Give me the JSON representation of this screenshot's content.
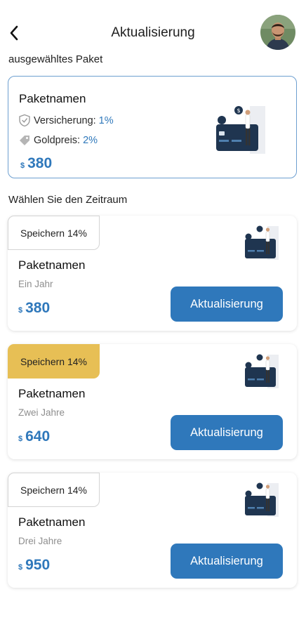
{
  "header": {
    "title": "Aktualisierung",
    "back_icon": "chevron-left-icon",
    "avatar": "user-avatar"
  },
  "selected_section": {
    "label": "ausgewähltes Paket",
    "card": {
      "name": "Paketnamen",
      "insurance_label": "Versicherung:",
      "insurance_value": "1%",
      "gold_label": "Goldpreis:",
      "gold_value": "2%",
      "currency": "$",
      "price": "380",
      "illustration_icon": "payment-card-illustration"
    }
  },
  "period_section": {
    "label": "Wählen Sie den Zeitraum"
  },
  "plans": [
    {
      "badge": "Speichern 14%",
      "badge_style": "outline",
      "name": "Paketnamen",
      "period": "Ein Jahr",
      "currency": "$",
      "price": "380",
      "button": "Aktualisierung"
    },
    {
      "badge": "Speichern 14%",
      "badge_style": "gold",
      "name": "Paketnamen",
      "period": "Zwei Jahre",
      "currency": "$",
      "price": "640",
      "button": "Aktualisierung"
    },
    {
      "badge": "Speichern 14%",
      "badge_style": "outline",
      "name": "Paketnamen",
      "period": "Drei Jahre",
      "currency": "$",
      "price": "950",
      "button": "Aktualisierung"
    }
  ],
  "colors": {
    "accent": "#2f78bb",
    "gold_badge": "#e7bf55",
    "selected_border": "#6d9fd0",
    "muted_text": "#8e8e8e"
  }
}
